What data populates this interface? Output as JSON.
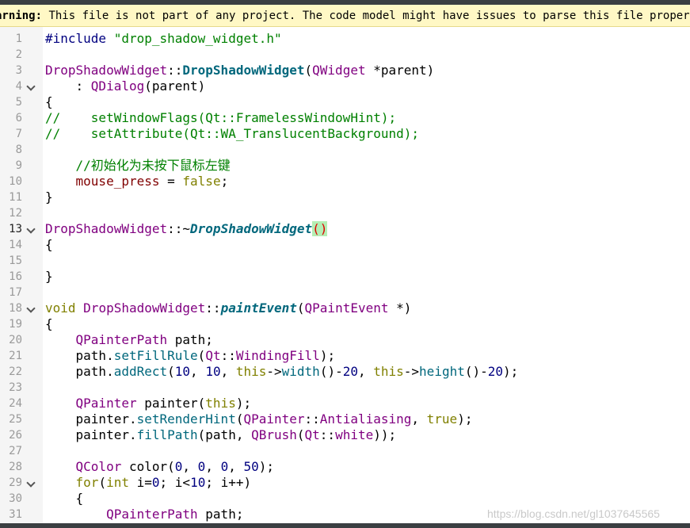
{
  "top_strip": {
    "text": ""
  },
  "warning": {
    "label": "arning:",
    "message": " This file is not part of any project. The code model might have issues to parse this file properly."
  },
  "watermark": "https://blog.csdn.net/gl1037645565",
  "current_line": 13,
  "colors": {
    "gutter_bg": "#f5f5f5",
    "warning_bg": "#fff8c5",
    "comment": "#008000",
    "keyword": "#808000",
    "class": "#800080",
    "declaration": "#00677c",
    "member": "#800000",
    "number": "#000080"
  },
  "lines": [
    {
      "n": "1",
      "fold": false,
      "tokens": [
        {
          "t": "#include ",
          "c": "prep"
        },
        {
          "t": "\"drop_shadow_widget.h\"",
          "c": "str"
        }
      ]
    },
    {
      "n": "2",
      "fold": false,
      "tokens": []
    },
    {
      "n": "3",
      "fold": false,
      "tokens": [
        {
          "t": "DropShadowWidget",
          "c": "class"
        },
        {
          "t": "::",
          "c": "default"
        },
        {
          "t": "DropShadowWidget",
          "c": "decl"
        },
        {
          "t": "(",
          "c": "default"
        },
        {
          "t": "QWidget",
          "c": "class"
        },
        {
          "t": " *parent)",
          "c": "default"
        }
      ]
    },
    {
      "n": "4",
      "fold": true,
      "tokens": [
        {
          "t": "    : ",
          "c": "default"
        },
        {
          "t": "QDialog",
          "c": "class"
        },
        {
          "t": "(parent)",
          "c": "default"
        }
      ]
    },
    {
      "n": "5",
      "fold": false,
      "tokens": [
        {
          "t": "{",
          "c": "default"
        }
      ]
    },
    {
      "n": "6",
      "fold": false,
      "tokens": [
        {
          "t": "//    setWindowFlags(Qt::FramelessWindowHint);",
          "c": "comment"
        }
      ]
    },
    {
      "n": "7",
      "fold": false,
      "tokens": [
        {
          "t": "//    setAttribute(Qt::WA_TranslucentBackground);",
          "c": "comment"
        }
      ]
    },
    {
      "n": "8",
      "fold": false,
      "tokens": []
    },
    {
      "n": "9",
      "fold": false,
      "tokens": [
        {
          "t": "    //初始化为未按下鼠标左键",
          "c": "comment"
        }
      ]
    },
    {
      "n": "10",
      "fold": false,
      "tokens": [
        {
          "t": "    ",
          "c": "default"
        },
        {
          "t": "mouse_press",
          "c": "member"
        },
        {
          "t": " = ",
          "c": "default"
        },
        {
          "t": "false",
          "c": "kw"
        },
        {
          "t": ";",
          "c": "default"
        }
      ]
    },
    {
      "n": "11",
      "fold": false,
      "tokens": [
        {
          "t": "}",
          "c": "default"
        }
      ]
    },
    {
      "n": "12",
      "fold": false,
      "tokens": []
    },
    {
      "n": "13",
      "fold": true,
      "tokens": [
        {
          "t": "DropShadowWidget",
          "c": "class"
        },
        {
          "t": "::~",
          "c": "default"
        },
        {
          "t": "DropShadowWidget",
          "c": "decl-it"
        },
        {
          "t": "()",
          "c": "paren-hl"
        }
      ]
    },
    {
      "n": "14",
      "fold": false,
      "tokens": [
        {
          "t": "{",
          "c": "default"
        }
      ]
    },
    {
      "n": "15",
      "fold": false,
      "tokens": []
    },
    {
      "n": "16",
      "fold": false,
      "tokens": [
        {
          "t": "}",
          "c": "default"
        }
      ]
    },
    {
      "n": "17",
      "fold": false,
      "tokens": []
    },
    {
      "n": "18",
      "fold": true,
      "tokens": [
        {
          "t": "void",
          "c": "kw"
        },
        {
          "t": " ",
          "c": "default"
        },
        {
          "t": "DropShadowWidget",
          "c": "class"
        },
        {
          "t": "::",
          "c": "default"
        },
        {
          "t": "paintEvent",
          "c": "decl-it"
        },
        {
          "t": "(",
          "c": "default"
        },
        {
          "t": "QPaintEvent",
          "c": "class"
        },
        {
          "t": " *)",
          "c": "default"
        }
      ]
    },
    {
      "n": "19",
      "fold": false,
      "tokens": [
        {
          "t": "{",
          "c": "default"
        }
      ]
    },
    {
      "n": "20",
      "fold": false,
      "tokens": [
        {
          "t": "    ",
          "c": "default"
        },
        {
          "t": "QPainterPath",
          "c": "class"
        },
        {
          "t": " path;",
          "c": "default"
        }
      ]
    },
    {
      "n": "21",
      "fold": false,
      "tokens": [
        {
          "t": "    path.",
          "c": "default"
        },
        {
          "t": "setFillRule",
          "c": "func"
        },
        {
          "t": "(",
          "c": "default"
        },
        {
          "t": "Qt",
          "c": "class"
        },
        {
          "t": "::",
          "c": "default"
        },
        {
          "t": "WindingFill",
          "c": "enum"
        },
        {
          "t": ");",
          "c": "default"
        }
      ]
    },
    {
      "n": "22",
      "fold": false,
      "tokens": [
        {
          "t": "    path.",
          "c": "default"
        },
        {
          "t": "addRect",
          "c": "func"
        },
        {
          "t": "(",
          "c": "default"
        },
        {
          "t": "10",
          "c": "num"
        },
        {
          "t": ", ",
          "c": "default"
        },
        {
          "t": "10",
          "c": "num"
        },
        {
          "t": ", ",
          "c": "default"
        },
        {
          "t": "this",
          "c": "kw"
        },
        {
          "t": "->",
          "c": "default"
        },
        {
          "t": "width",
          "c": "func"
        },
        {
          "t": "()-",
          "c": "default"
        },
        {
          "t": "20",
          "c": "num"
        },
        {
          "t": ", ",
          "c": "default"
        },
        {
          "t": "this",
          "c": "kw"
        },
        {
          "t": "->",
          "c": "default"
        },
        {
          "t": "height",
          "c": "func"
        },
        {
          "t": "()-",
          "c": "default"
        },
        {
          "t": "20",
          "c": "num"
        },
        {
          "t": ");",
          "c": "default"
        }
      ]
    },
    {
      "n": "23",
      "fold": false,
      "tokens": []
    },
    {
      "n": "24",
      "fold": false,
      "tokens": [
        {
          "t": "    ",
          "c": "default"
        },
        {
          "t": "QPainter",
          "c": "class"
        },
        {
          "t": " painter(",
          "c": "default"
        },
        {
          "t": "this",
          "c": "kw"
        },
        {
          "t": ");",
          "c": "default"
        }
      ]
    },
    {
      "n": "25",
      "fold": false,
      "tokens": [
        {
          "t": "    painter.",
          "c": "default"
        },
        {
          "t": "setRenderHint",
          "c": "func"
        },
        {
          "t": "(",
          "c": "default"
        },
        {
          "t": "QPainter",
          "c": "class"
        },
        {
          "t": "::",
          "c": "default"
        },
        {
          "t": "Antialiasing",
          "c": "enum"
        },
        {
          "t": ", ",
          "c": "default"
        },
        {
          "t": "true",
          "c": "kw"
        },
        {
          "t": ");",
          "c": "default"
        }
      ]
    },
    {
      "n": "26",
      "fold": false,
      "tokens": [
        {
          "t": "    painter.",
          "c": "default"
        },
        {
          "t": "fillPath",
          "c": "func"
        },
        {
          "t": "(path, ",
          "c": "default"
        },
        {
          "t": "QBrush",
          "c": "class"
        },
        {
          "t": "(",
          "c": "default"
        },
        {
          "t": "Qt",
          "c": "class"
        },
        {
          "t": "::",
          "c": "default"
        },
        {
          "t": "white",
          "c": "enum"
        },
        {
          "t": "));",
          "c": "default"
        }
      ]
    },
    {
      "n": "27",
      "fold": false,
      "tokens": []
    },
    {
      "n": "28",
      "fold": false,
      "tokens": [
        {
          "t": "    ",
          "c": "default"
        },
        {
          "t": "QColor",
          "c": "class"
        },
        {
          "t": " color(",
          "c": "default"
        },
        {
          "t": "0",
          "c": "num"
        },
        {
          "t": ", ",
          "c": "default"
        },
        {
          "t": "0",
          "c": "num"
        },
        {
          "t": ", ",
          "c": "default"
        },
        {
          "t": "0",
          "c": "num"
        },
        {
          "t": ", ",
          "c": "default"
        },
        {
          "t": "50",
          "c": "num"
        },
        {
          "t": ");",
          "c": "default"
        }
      ]
    },
    {
      "n": "29",
      "fold": true,
      "tokens": [
        {
          "t": "    ",
          "c": "default"
        },
        {
          "t": "for",
          "c": "kw"
        },
        {
          "t": "(",
          "c": "default"
        },
        {
          "t": "int",
          "c": "kw"
        },
        {
          "t": " i=",
          "c": "default"
        },
        {
          "t": "0",
          "c": "num"
        },
        {
          "t": "; i<",
          "c": "default"
        },
        {
          "t": "10",
          "c": "num"
        },
        {
          "t": "; i++)",
          "c": "default"
        }
      ]
    },
    {
      "n": "30",
      "fold": false,
      "tokens": [
        {
          "t": "    {",
          "c": "default"
        }
      ]
    },
    {
      "n": "31",
      "fold": false,
      "tokens": [
        {
          "t": "        ",
          "c": "default"
        },
        {
          "t": "QPainterPath",
          "c": "class"
        },
        {
          "t": " path;",
          "c": "default"
        }
      ]
    }
  ]
}
